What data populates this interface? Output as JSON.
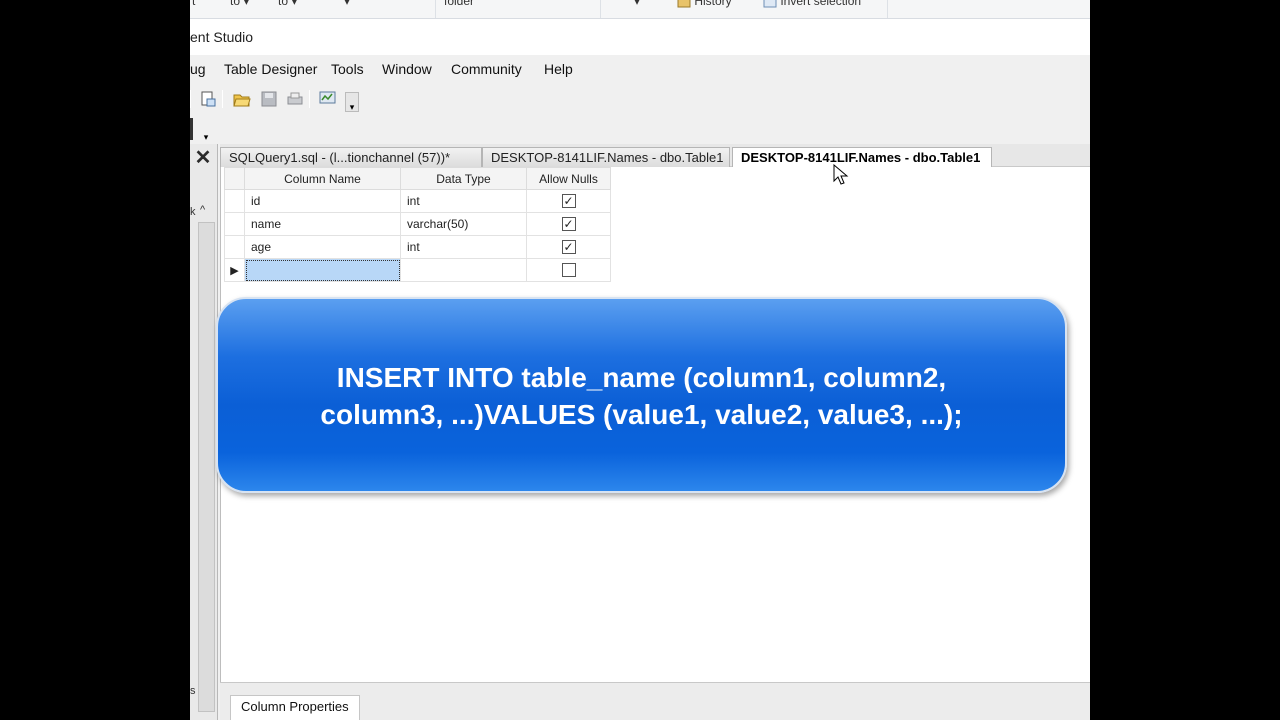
{
  "ribbon": {
    "item1": "t",
    "item2": "to ▾",
    "item3": "to ▾",
    "item4": "▾",
    "item5": "folder",
    "item6": "▾",
    "history": "History",
    "invert": "Invert selection"
  },
  "window": {
    "title": "ent Studio"
  },
  "menu": {
    "items": [
      "ug",
      "Table Designer",
      "Tools",
      "Window",
      "Community",
      "Help"
    ]
  },
  "left_panel": {
    "close_glyph": "✕",
    "k": "k",
    "up": "^",
    "s": "s"
  },
  "tabs": [
    {
      "label": "SQLQuery1.sql - (l...tionchannel (57))*"
    },
    {
      "label": "DESKTOP-8141LIF.Names - dbo.Table1"
    },
    {
      "label": "DESKTOP-8141LIF.Names - dbo.Table1"
    }
  ],
  "grid": {
    "headers": [
      "Column Name",
      "Data Type",
      "Allow Nulls"
    ],
    "rows": [
      {
        "name": "id",
        "type": "int",
        "allow_nulls": true
      },
      {
        "name": "name",
        "type": "varchar(50)",
        "allow_nulls": true
      },
      {
        "name": "age",
        "type": "int",
        "allow_nulls": true
      },
      {
        "name": "",
        "type": "",
        "allow_nulls": false,
        "current": true
      }
    ],
    "row_indicator": "▶"
  },
  "overlay": {
    "line1": "INSERT INTO table_name (column1, column2,",
    "line2": "column3, ...)VALUES (value1, value2, value3, ...);"
  },
  "bottom": {
    "tab_label": "Column Properties"
  },
  "colors": {
    "overlay_top": "#5b9ff0",
    "overlay_mid": "#0b5fd6",
    "selection": "#b8d7f7"
  }
}
